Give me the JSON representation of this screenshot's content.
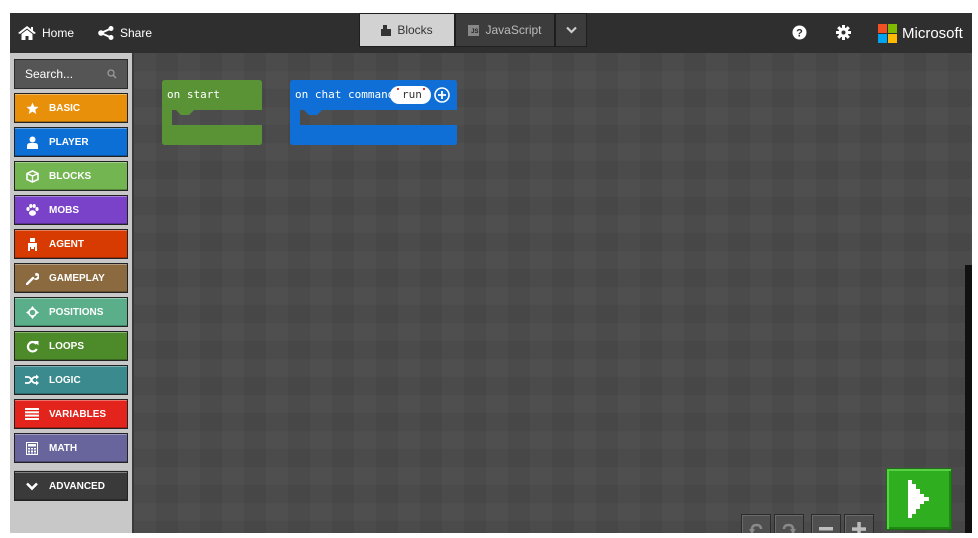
{
  "topbar": {
    "home_label": "Home",
    "share_label": "Share",
    "tabs": [
      {
        "label": "Blocks",
        "active": true
      },
      {
        "label": "JavaScript",
        "active": false
      }
    ],
    "js_badge": "JS",
    "brand": "Microsoft",
    "icons": [
      "home-icon",
      "share-icon",
      "blocks-icon",
      "javascript-icon",
      "chevron-down-icon",
      "help-icon",
      "gear-icon",
      "microsoft-logo"
    ]
  },
  "sidebar": {
    "search_placeholder": "Search...",
    "categories": [
      {
        "label": "BASIC",
        "color": "#e8900a",
        "icon": "star-icon"
      },
      {
        "label": "PLAYER",
        "color": "#0c6fd6",
        "icon": "player-icon"
      },
      {
        "label": "BLOCKS",
        "color": "#73b550",
        "icon": "cube-icon"
      },
      {
        "label": "MOBS",
        "color": "#7a41c9",
        "icon": "paw-icon"
      },
      {
        "label": "AGENT",
        "color": "#d83b01",
        "icon": "agent-icon"
      },
      {
        "label": "GAMEPLAY",
        "color": "#8a6a3e",
        "icon": "wrench-icon"
      },
      {
        "label": "POSITIONS",
        "color": "#5aaf8a",
        "icon": "crosshair-icon"
      },
      {
        "label": "LOOPS",
        "color": "#4d8a2a",
        "icon": "loop-icon"
      },
      {
        "label": "LOGIC",
        "color": "#3a8a8e",
        "icon": "shuffle-icon"
      },
      {
        "label": "VARIABLES",
        "color": "#e2241c",
        "icon": "list-icon"
      },
      {
        "label": "MATH",
        "color": "#67659c",
        "icon": "calculator-icon"
      }
    ],
    "advanced_label": "ADVANCED"
  },
  "workspace": {
    "blocks": [
      {
        "label": "on start",
        "color": "#5a9236"
      },
      {
        "label": "on chat command",
        "color": "#0f6fd6",
        "param": "run"
      }
    ]
  },
  "controls": {
    "undo": "undo-icon",
    "redo": "redo-icon",
    "zoom_out": "zoom-out-icon",
    "zoom_in": "zoom-in-icon",
    "run": "play-icon",
    "run_color": "#2faf1f"
  }
}
